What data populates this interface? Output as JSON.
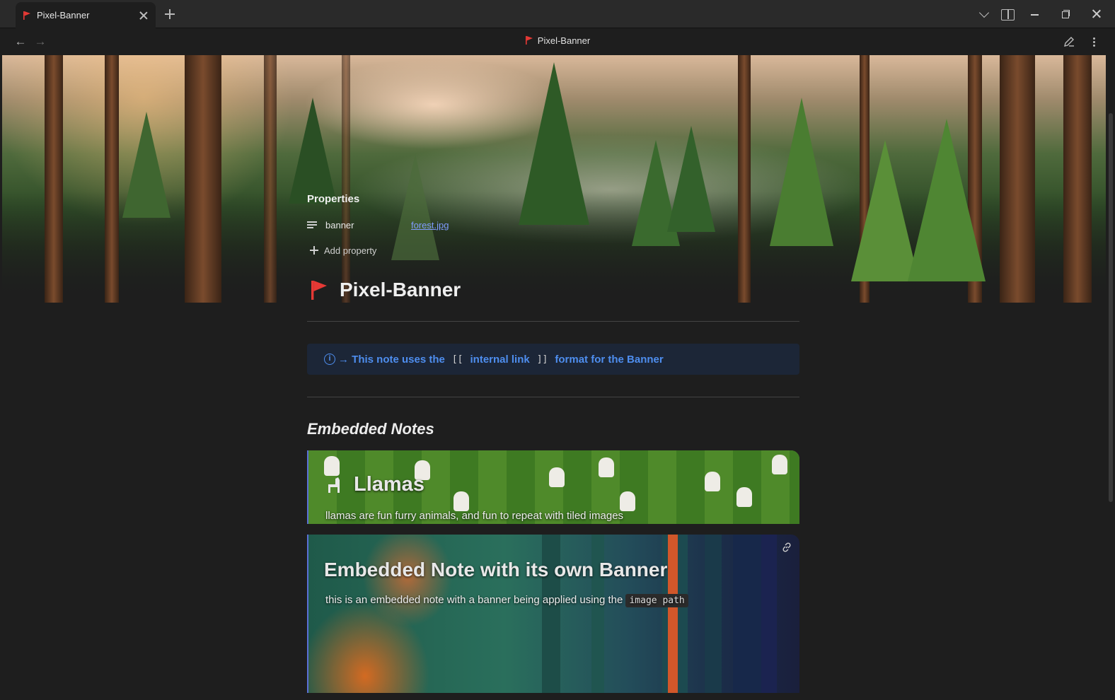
{
  "tab": {
    "title": "Pixel-Banner"
  },
  "view": {
    "title": "Pixel-Banner"
  },
  "colors": {
    "accent": "#4e8eef",
    "link": "#7f9cff",
    "flag": "#e53935",
    "background": "#1e1e1e",
    "callout_bg": "#1c2637"
  },
  "icons": {
    "tab": "flag-icon",
    "close": "close-icon",
    "new_tab": "plus-icon",
    "tab_list": "chevron-down-icon",
    "sidebar": "split-view-icon",
    "minimize": "minimize-icon",
    "maximize": "restore-icon",
    "close_window": "close-icon",
    "back": "arrow-left-icon",
    "forward": "arrow-right-icon",
    "edit": "pencil-icon",
    "more": "more-vertical-icon",
    "property_type": "text-lines-icon",
    "add_property": "plus-icon",
    "callout": "info-icon",
    "embed_link": "link-icon"
  },
  "nav": {
    "back": "←",
    "forward": "→"
  },
  "properties": {
    "heading": "Properties",
    "items": [
      {
        "key": "banner",
        "value": "forest.jpg"
      }
    ],
    "add_label": "Add property"
  },
  "note": {
    "title": "Pixel-Banner"
  },
  "callout": {
    "icon_text": "i",
    "prefix": "→ This note uses the",
    "open_brackets": "[[",
    "link_text": "internal link",
    "close_brackets": "]]",
    "suffix": "format for the Banner"
  },
  "embedded_section": {
    "heading": "Embedded Notes"
  },
  "embeds": [
    {
      "title": "Llamas",
      "text": "llamas are fun furry animals, and fun to repeat with tiled images"
    },
    {
      "title": "Embedded Note with its own Banner",
      "text": "this is an embedded note with a banner being applied using the",
      "code": "image path"
    }
  ]
}
